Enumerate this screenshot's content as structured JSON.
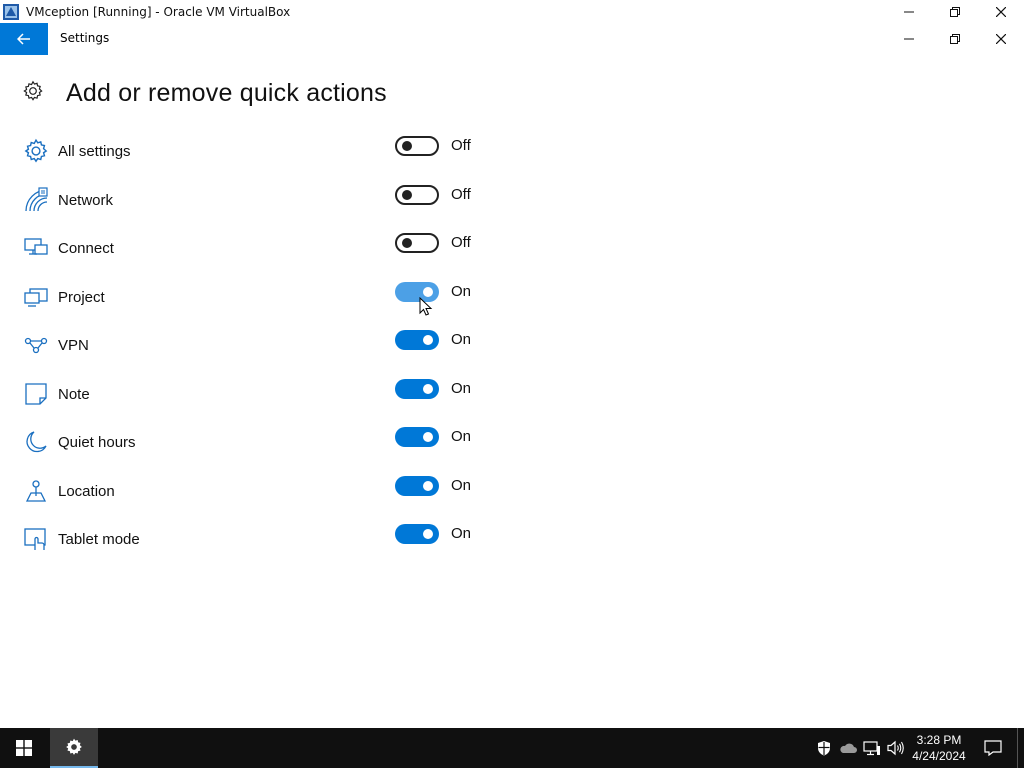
{
  "host_window": {
    "title": "VMception [Running] - Oracle VM VirtualBox",
    "logo_icon": "virtualbox-logo-icon",
    "controls": [
      "minimize-icon",
      "restore-icon",
      "close-icon"
    ]
  },
  "app": {
    "title": "Settings",
    "back_icon": "back-arrow-icon",
    "accent_color": "#0078d7",
    "controls": [
      "minimize-icon",
      "restore-icon",
      "close-icon"
    ]
  },
  "page": {
    "header_icon": "gear-icon",
    "title": "Add or remove quick actions"
  },
  "quick_actions": [
    {
      "label": "All settings",
      "icon": "all-settings-gear-icon",
      "on": false,
      "state": "Off"
    },
    {
      "label": "Network",
      "icon": "network-icon",
      "on": false,
      "state": "Off"
    },
    {
      "label": "Connect",
      "icon": "connect-icon",
      "on": false,
      "state": "Off"
    },
    {
      "label": "Project",
      "icon": "project-icon",
      "on": true,
      "state": "On"
    },
    {
      "label": "VPN",
      "icon": "vpn-icon",
      "on": true,
      "state": "On"
    },
    {
      "label": "Note",
      "icon": "note-icon",
      "on": true,
      "state": "On"
    },
    {
      "label": "Quiet hours",
      "icon": "moon-icon",
      "on": true,
      "state": "On"
    },
    {
      "label": "Location",
      "icon": "location-icon",
      "on": true,
      "state": "On"
    },
    {
      "label": "Tablet mode",
      "icon": "tablet-mode-icon",
      "on": true,
      "state": "On"
    }
  ],
  "taskbar": {
    "start_icon": "windows-logo-icon",
    "pinned": [
      {
        "name": "settings-taskbar-icon",
        "active": true
      }
    ],
    "tray_icons": [
      "defender-shield-icon",
      "onedrive-cloud-icon",
      "network-tray-icon",
      "volume-icon"
    ],
    "clock": {
      "time": "3:28 PM",
      "date": "4/24/2024"
    },
    "notification_icon": "action-center-icon"
  }
}
